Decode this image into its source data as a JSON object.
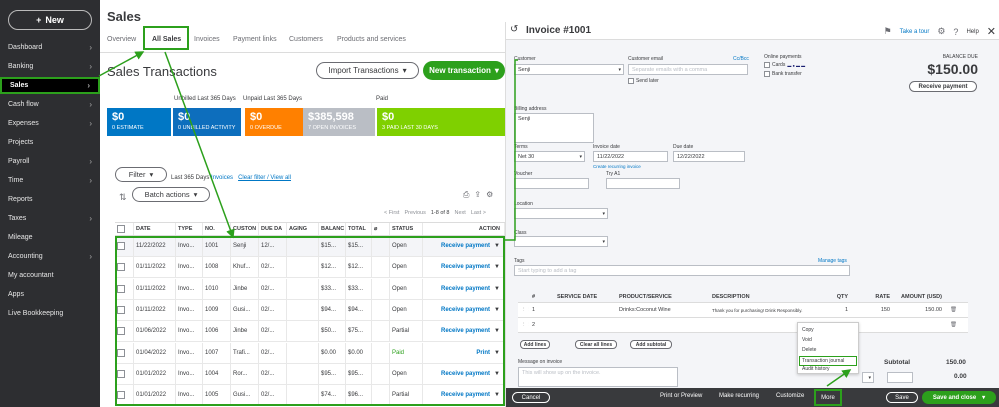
{
  "sidebar": {
    "new_label": "New",
    "items": [
      {
        "label": "Dashboard",
        "chevron": true
      },
      {
        "label": "Banking",
        "chevron": true
      },
      {
        "label": "Sales",
        "chevron": true,
        "active": true
      },
      {
        "label": "Cash flow",
        "chevron": true
      },
      {
        "label": "Expenses",
        "chevron": true
      },
      {
        "label": "Projects",
        "chevron": false
      },
      {
        "label": "Payroll",
        "chevron": true
      },
      {
        "label": "Time",
        "chevron": true
      },
      {
        "label": "Reports",
        "chevron": false
      },
      {
        "label": "Taxes",
        "chevron": true
      },
      {
        "label": "Mileage",
        "chevron": false
      },
      {
        "label": "Accounting",
        "chevron": true
      },
      {
        "label": "My accountant",
        "chevron": false
      },
      {
        "label": "Apps",
        "chevron": false
      },
      {
        "label": "Live Bookkeeping",
        "chevron": false
      }
    ]
  },
  "sales": {
    "page_title": "Sales",
    "tabs": [
      "Overview",
      "All Sales",
      "Invoices",
      "Payment links",
      "Customers",
      "Products and services"
    ],
    "section_title": "Sales Transactions",
    "import_label": "Import Transactions",
    "new_transaction_label": "New transaction",
    "captions": {
      "unbilled": "Unbilled Last 365 Days",
      "unpaid": "Unpaid Last 365 Days",
      "paid": "Paid"
    },
    "cards": [
      {
        "amount": "$0",
        "label": "0 ESTIMATE",
        "color": "#0077c5"
      },
      {
        "amount": "$0",
        "label": "0 UNBILLED ACTIVITY",
        "color": "#0d6ebd"
      },
      {
        "amount": "$0",
        "label": "0 OVERDUE",
        "color": "#ff8000"
      },
      {
        "amount": "$385,598",
        "label": "7 OPEN INVOICES",
        "color": "#babec5"
      },
      {
        "amount": "$0",
        "label": "3 PAID LAST 30 DAYS",
        "color": "#7fd000"
      }
    ],
    "filter_label": "Filter",
    "filter_text": "Last 365 Days",
    "filter_invoices": "Invoices",
    "filter_clear": "Clear filter / View all",
    "batch_label": "Batch actions",
    "pagination": {
      "first": "< First",
      "previous": "Previous",
      "range": "1-8 of 8",
      "next": "Next",
      "last": "Last >"
    },
    "columns": [
      "DATE",
      "TYPE",
      "NO.",
      "CUSTON",
      "DUE DA",
      "AGING",
      "BALANC",
      "TOTAL",
      "",
      "STATUS",
      "ACTION"
    ],
    "rows": [
      {
        "date": "11/22/2022",
        "type": "Invo...",
        "no": "1001",
        "customer": "Senji",
        "due": "12/...",
        "aging": "",
        "balance": "$15...",
        "total": "$15...",
        "status": "Open",
        "action": "Receive payment"
      },
      {
        "date": "01/11/2022",
        "type": "Invo...",
        "no": "1008",
        "customer": "Khuf...",
        "due": "02/...",
        "aging": "",
        "balance": "$12...",
        "total": "$12...",
        "status": "Open",
        "action": "Receive payment"
      },
      {
        "date": "01/11/2022",
        "type": "Invo...",
        "no": "1010",
        "customer": "Jinbe",
        "due": "02/...",
        "aging": "",
        "balance": "$33...",
        "total": "$33...",
        "status": "Open",
        "action": "Receive payment"
      },
      {
        "date": "01/11/2022",
        "type": "Invo...",
        "no": "1009",
        "customer": "Gusi...",
        "due": "02/...",
        "aging": "",
        "balance": "$94...",
        "total": "$94...",
        "status": "Open",
        "action": "Receive payment"
      },
      {
        "date": "01/06/2022",
        "type": "Invo...",
        "no": "1006",
        "customer": "Jinbe",
        "due": "02/...",
        "aging": "",
        "balance": "$50...",
        "total": "$75...",
        "status": "Partial",
        "action": "Receive payment"
      },
      {
        "date": "01/04/2022",
        "type": "Invo...",
        "no": "1007",
        "customer": "Trafi...",
        "due": "02/...",
        "aging": "",
        "balance": "$0.00",
        "total": "$0.00",
        "status": "Paid",
        "action": "Print"
      },
      {
        "date": "01/01/2022",
        "type": "Invo...",
        "no": "1004",
        "customer": "Ror...",
        "due": "02/...",
        "aging": "",
        "balance": "$95...",
        "total": "$95...",
        "status": "Open",
        "action": "Receive payment"
      },
      {
        "date": "01/01/2022",
        "type": "Invo...",
        "no": "1005",
        "customer": "Gusi...",
        "due": "02/...",
        "aging": "",
        "balance": "$74...",
        "total": "$96...",
        "status": "Partial",
        "action": "Receive payment"
      }
    ]
  },
  "invoice": {
    "title": "Invoice #1001",
    "take_tour": "Take a tour",
    "help": "Help",
    "customer_label": "Customer",
    "customer_value": "Senji",
    "email_label": "Customer email",
    "email_placeholder": "Separate emails with a comma",
    "ccbcc": "Cc/Bcc",
    "send_later": "Send later",
    "online_payments_label": "Online payments",
    "cards_label": "Cards",
    "bank_transfer_label": "Bank transfer",
    "balance_due_label": "BALANCE DUE",
    "balance_due_amount": "$150.00",
    "receive_payment": "Receive payment",
    "billing_label": "Billing address",
    "billing_value": "Senji",
    "terms_label": "Terms",
    "terms_value": "Net 30",
    "invoice_date_label": "Invoice date",
    "invoice_date_value": "11/22/2022",
    "due_date_label": "Due date",
    "due_date_value": "12/22/2022",
    "create_recurring": "Create recurring invoice",
    "voucher_label": "Voucher",
    "try_label": "Try A1",
    "location_label": "Location",
    "class_label": "Class",
    "tags_label": "Tags",
    "manage_tags": "Manage tags",
    "tags_placeholder": "Start typing to add a tag",
    "line_columns": [
      "",
      "#",
      "SERVICE DATE",
      "PRODUCT/SERVICE",
      "DESCRIPTION",
      "QTY",
      "RATE",
      "AMOUNT (USD)"
    ],
    "lines": [
      {
        "num": "1",
        "service_date": "",
        "product": "Drinks:Coconut Wine",
        "description": "Thank you for purchasing! Drink Responsibly.",
        "qty": "1",
        "rate": "150",
        "amount": "150.00"
      },
      {
        "num": "2",
        "service_date": "",
        "product": "",
        "description": "",
        "qty": "",
        "rate": "",
        "amount": ""
      }
    ],
    "add_lines": "Add lines",
    "clear_all_lines": "Clear all lines",
    "add_subtotal": "Add subtotal",
    "message_label": "Message on invoice",
    "message_placeholder": "This will show up on the invoice.",
    "subtotal_label": "Subtotal",
    "subtotal_value": "150.00",
    "total_value": "0.00",
    "more_menu": [
      "Copy",
      "Void",
      "Delete",
      "Transaction journal",
      "Audit history"
    ],
    "footer": {
      "cancel": "Cancel",
      "print": "Print or Preview",
      "recurring": "Make recurring",
      "customize": "Customize",
      "more": "More",
      "save": "Save",
      "save_close": "Save and close"
    }
  }
}
